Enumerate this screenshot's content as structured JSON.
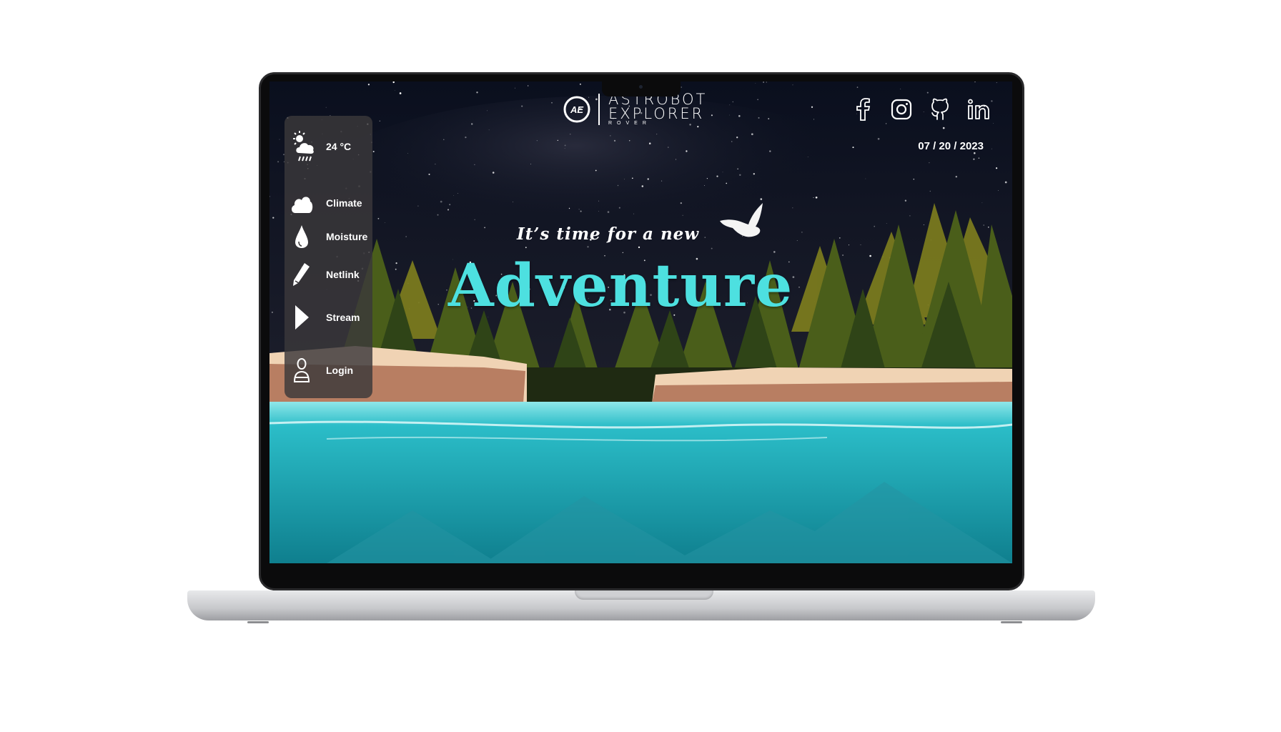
{
  "brand": {
    "logo_text": "AE",
    "line1": "ASTROBOT",
    "line2": "EXPLORER",
    "sub": "ROVER"
  },
  "header": {
    "date": "07 / 20 / 2023"
  },
  "socials": [
    "facebook-icon",
    "instagram-icon",
    "github-icon",
    "linkedin-icon"
  ],
  "weather": {
    "icon": "partly-cloudy-rain-icon",
    "temp": "24 °C"
  },
  "nav": [
    {
      "label": "Climate",
      "icon": "cloud-icon"
    },
    {
      "label": "Moisture",
      "icon": "droplet-icon"
    },
    {
      "label": "Netlink",
      "icon": "pencil-icon"
    },
    {
      "label": "Stream",
      "icon": "play-icon"
    },
    {
      "label": "Login",
      "icon": "user-icon"
    }
  ],
  "hero": {
    "tagline": "It’s time for a new",
    "headline": "Adventure"
  },
  "colors": {
    "accent": "#4de0e0",
    "sky": "#0a0f1e",
    "water": "#1aa7b5",
    "forest": "#4a5e1a"
  }
}
